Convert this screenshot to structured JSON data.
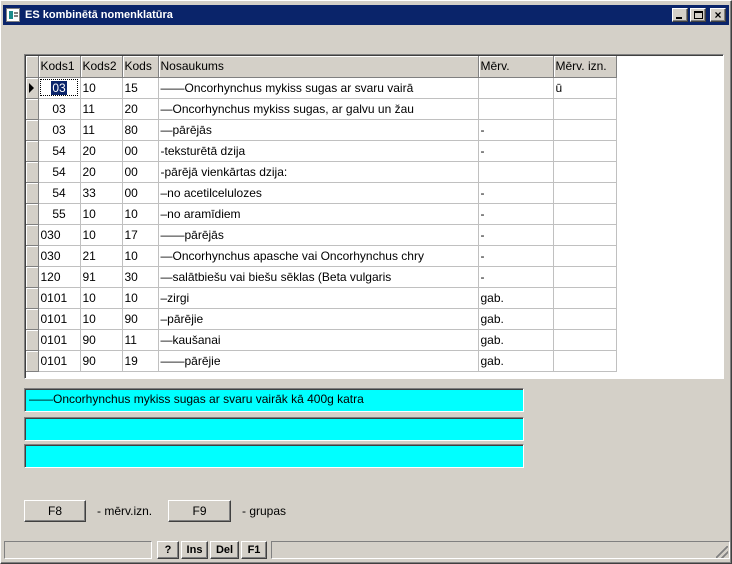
{
  "window": {
    "title": "ES kombinētā nomenklatūra",
    "controls": {
      "minimize": "minimize",
      "maximize": "maximize",
      "close": "×"
    }
  },
  "grid": {
    "columns": [
      "Kods1",
      "Kods2",
      "Kods",
      "Nosaukums",
      "Mērv.",
      "Mērv. izn."
    ],
    "rows": [
      [
        "03",
        "10",
        "15",
        "——Oncorhynchus mykiss sugas ar svaru vairā",
        "",
        "ū"
      ],
      [
        "03",
        "11",
        "20",
        "—Oncorhynchus mykiss sugas, ar galvu un žau",
        "",
        ""
      ],
      [
        "03",
        "11",
        "80",
        "—pārējās",
        "-",
        ""
      ],
      [
        "54",
        "20",
        "00",
        "-teksturētā dzija",
        "-",
        ""
      ],
      [
        "54",
        "20",
        "00",
        "-pārējā vienkārtas dzija:",
        "",
        ""
      ],
      [
        "54",
        "33",
        "00",
        "–no acetilcelulozes",
        "-",
        ""
      ],
      [
        "55",
        "10",
        "10",
        "–no aramīdiem",
        "-",
        ""
      ],
      [
        "030",
        "10",
        "17",
        "——pārējās",
        "-",
        ""
      ],
      [
        "030",
        "21",
        "10",
        "—Oncorhynchus apasche vai Oncorhynchus chry",
        "-",
        ""
      ],
      [
        "120",
        "91",
        "30",
        "—salātbiešu vai biešu sēklas (Beta vulgaris",
        "-",
        ""
      ],
      [
        "0101",
        "10",
        "10",
        "–zirgi",
        "gab.",
        ""
      ],
      [
        "0101",
        "10",
        "90",
        "–pārējie",
        "gab.",
        ""
      ],
      [
        "0101",
        "90",
        "11",
        "—kaušanai",
        "gab.",
        ""
      ],
      [
        "0101",
        "90",
        "19",
        "——pārējie",
        "gab.",
        ""
      ]
    ],
    "selected_row": 0
  },
  "info": {
    "line1": "——Oncorhynchus mykiss sugas ar svaru vairāk kā 400g katra",
    "line2": "",
    "line3": ""
  },
  "actions": {
    "f8_label": "F8",
    "f8_hint": "- mērv.izn.",
    "f9_label": "F9",
    "f9_hint": "- grupas"
  },
  "statusbar": {
    "buttons": [
      "?",
      "Ins",
      "Del",
      "F1"
    ]
  },
  "colors": {
    "title_bar": "#0a246a",
    "face": "#d4d0c8",
    "info_field": "#00ffff",
    "selection": "#0a246a"
  }
}
